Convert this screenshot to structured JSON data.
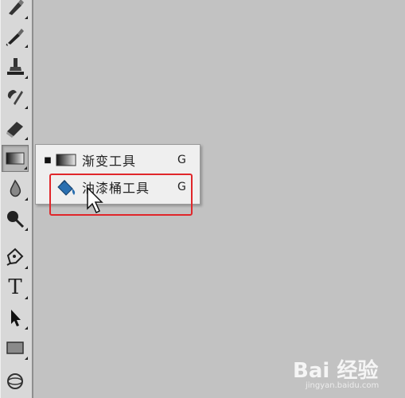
{
  "toolbar": {
    "tools": [
      {
        "name": "pencil-brush",
        "icon": "brush-icon"
      },
      {
        "name": "history-brush",
        "icon": "history-brush-icon"
      },
      {
        "name": "clone-stamp",
        "icon": "stamp-icon"
      },
      {
        "name": "art-history-brush",
        "icon": "art-brush-icon"
      },
      {
        "name": "eraser",
        "icon": "eraser-icon"
      },
      {
        "name": "gradient",
        "icon": "gradient-icon",
        "active": true
      },
      {
        "name": "blur",
        "icon": "drop-icon"
      },
      {
        "name": "dodge",
        "icon": "dodge-icon"
      },
      {
        "name": "pen",
        "icon": "pen-icon"
      },
      {
        "name": "type",
        "icon": "type-icon",
        "glyph": "T"
      },
      {
        "name": "path-selection",
        "icon": "arrow-icon"
      },
      {
        "name": "shape",
        "icon": "rectangle-icon"
      },
      {
        "name": "3d",
        "icon": "3d-icon"
      }
    ]
  },
  "flyout": {
    "items": [
      {
        "label": "渐变工具",
        "shortcut": "G",
        "checked": true,
        "icon": "gradient-icon"
      },
      {
        "label": "油漆桶工具",
        "shortcut": "G",
        "checked": false,
        "icon": "paint-bucket-icon"
      }
    ],
    "check_mark": "■"
  },
  "watermark": {
    "logo": "Bai 经验",
    "url": "jingyan.baidu.com"
  },
  "colors": {
    "canvas": "#c2c2c2",
    "toolbar": "#d8d8d8",
    "highlight": "#e0262a",
    "bucket_blue": "#2a6fb0"
  }
}
